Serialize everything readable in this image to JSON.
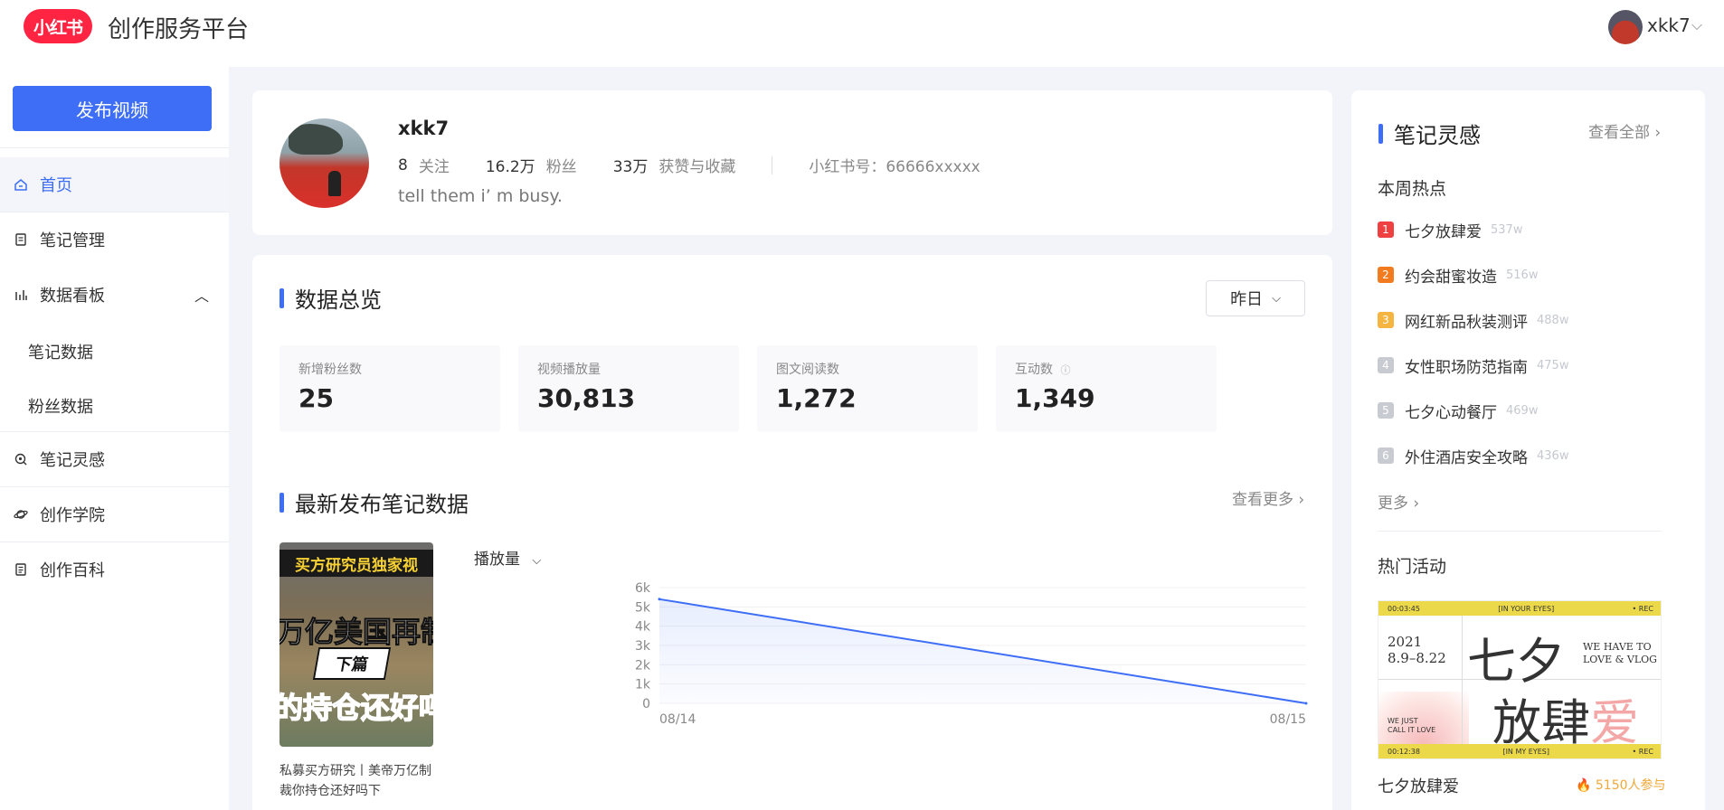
{
  "header": {
    "logo_text": "小红书",
    "platform_title": "创作服务平台",
    "user_name": "xkk7"
  },
  "sidebar": {
    "publish_label": "发布视频",
    "items": [
      {
        "label": "首页",
        "icon": "home-icon",
        "active": true
      },
      {
        "label": "笔记管理",
        "icon": "note-icon"
      },
      {
        "label": "数据看板",
        "icon": "chart-bars-icon",
        "expanded": true
      },
      {
        "label": "笔记数据",
        "sub": true
      },
      {
        "label": "粉丝数据",
        "sub": true
      },
      {
        "label": "笔记灵感",
        "icon": "bulb-icon"
      },
      {
        "label": "创作学院",
        "icon": "planet-icon"
      },
      {
        "label": "创作百科",
        "icon": "book-icon"
      }
    ]
  },
  "profile": {
    "name": "xkk7",
    "following_num": "8",
    "following_label": "关注",
    "fans_num": "16.2万",
    "fans_label": "粉丝",
    "likes_num": "33万",
    "likes_label": "获赞与收藏",
    "account_id": "小红书号：66666xxxxx",
    "bio": "tell them i’ m busy."
  },
  "overview": {
    "title": "数据总览",
    "date_select": "昨日",
    "metrics": [
      {
        "label": "新增粉丝数",
        "value": "25"
      },
      {
        "label": "视频播放量",
        "value": "30,813"
      },
      {
        "label": "图文阅读数",
        "value": "1,272"
      },
      {
        "label": "互动数",
        "value": "1,349",
        "info": true
      }
    ]
  },
  "latest": {
    "title": "最新发布笔记数据",
    "more": "查看更多 ›",
    "thumb_top": "买方研究员独家视",
    "thumb_mid": "万亿美国再制",
    "thumb_badge": "下篇",
    "thumb_bot": "的持仓还好吗",
    "caption": "私募买方研究丨美帝万亿制裁你持仓还好吗下",
    "metric_select": "播放量"
  },
  "chart_data": {
    "type": "line",
    "x": [
      "08/14",
      "08/15"
    ],
    "series": [
      {
        "values": [
          5400,
          0
        ]
      }
    ],
    "ylim": [
      0,
      6000
    ],
    "yticks": [
      "0",
      "1k",
      "2k",
      "3k",
      "4k",
      "5k",
      "6k"
    ],
    "grid": true,
    "color": "#3d6ef5"
  },
  "inspiration": {
    "title": "笔记灵感",
    "more": "查看全部 ›",
    "weekly_title": "本周热点",
    "hot": [
      {
        "rank": "1",
        "title": "七夕放肆爱",
        "count": "537w",
        "color": "#f04142"
      },
      {
        "rank": "2",
        "title": "约会甜蜜妆造",
        "count": "516w",
        "color": "#f27b1f"
      },
      {
        "rank": "3",
        "title": "网红新品秋装测评",
        "count": "488w",
        "color": "#f5b540"
      },
      {
        "rank": "4",
        "title": "女性职场防范指南",
        "count": "475w",
        "color": "#c8cbd2"
      },
      {
        "rank": "5",
        "title": "七夕心动餐厅",
        "count": "469w",
        "color": "#c8cbd2"
      },
      {
        "rank": "6",
        "title": "外住酒店安全攻略",
        "count": "436w",
        "color": "#c8cbd2"
      }
    ],
    "hot_more": "更多 ›",
    "events_title": "热门活动",
    "banner": {
      "bar_left": "00:03:45",
      "bar_mid": "[IN YOUR EYES]",
      "bar_right": "• REC",
      "bar2_left": "00:12:38",
      "bar2_mid": "[IN MY EYES]",
      "bar2_right": "• REC",
      "year": "2021",
      "dates": "8.9–8.22",
      "big1": "七夕",
      "big2a": "放肆",
      "big2b": "爱",
      "en1": "WE HAVE TO",
      "en2": "LOVE & VLOG",
      "small1": "WE JUST",
      "small2": "CALL IT LOVE"
    },
    "event_name": "七夕放肆爱",
    "event_join": "🔥 5150人参与"
  }
}
